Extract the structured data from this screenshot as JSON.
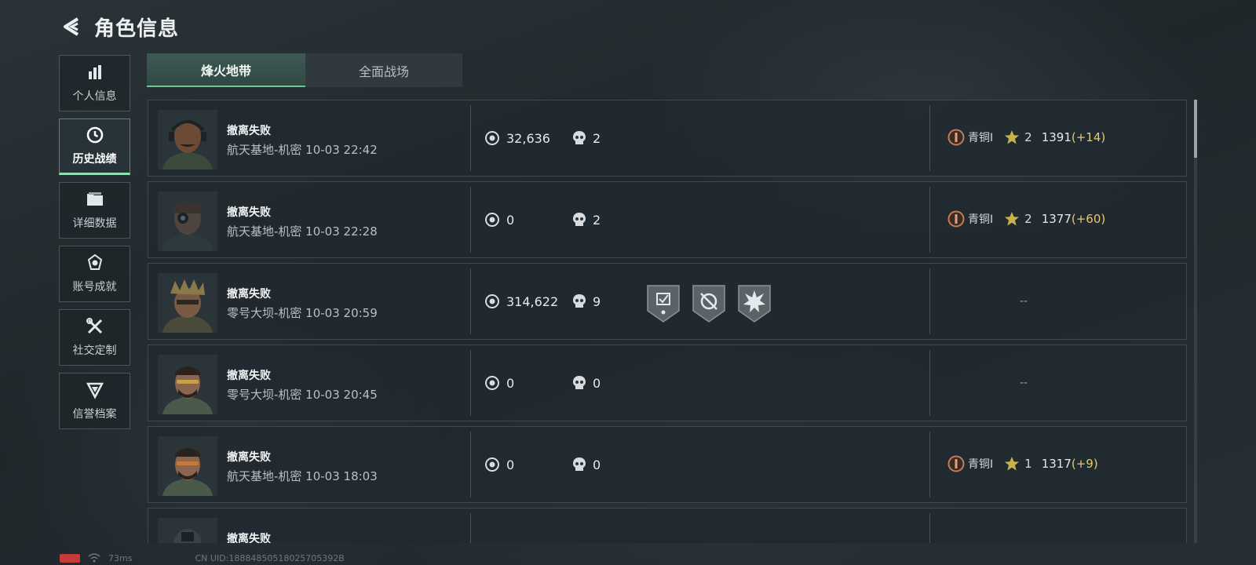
{
  "header": {
    "title": "角色信息"
  },
  "sidebar": {
    "items": [
      {
        "label": "个人信息",
        "icon": "bar-chart-icon"
      },
      {
        "label": "历史战绩",
        "icon": "history-clock-icon"
      },
      {
        "label": "详细数据",
        "icon": "folder-icon"
      },
      {
        "label": "账号成就",
        "icon": "achievement-icon"
      },
      {
        "label": "社交定制",
        "icon": "tools-icon"
      },
      {
        "label": "信誉档案",
        "icon": "shield-icon"
      }
    ],
    "active_index": 1
  },
  "tabs": [
    {
      "label": "烽火地带"
    },
    {
      "label": "全面战场"
    }
  ],
  "matches": [
    {
      "status": "撤离失败",
      "map_time": "航天基地-机密 10-03 22:42",
      "coins": "32,636",
      "kills": "2",
      "rank": {
        "name": "青铜I",
        "stars": "2",
        "score": "1391",
        "delta": "(+14)"
      }
    },
    {
      "status": "撤离失败",
      "map_time": "航天基地-机密 10-03 22:28",
      "coins": "0",
      "kills": "2",
      "rank": {
        "name": "青铜I",
        "stars": "2",
        "score": "1377",
        "delta": "(+60)"
      }
    },
    {
      "status": "撤离失败",
      "map_time": "零号大坝-机密 10-03 20:59",
      "coins": "314,622",
      "kills": "9",
      "badges": [
        "medal-badge-icon",
        "target-badge-icon",
        "explosion-badge-icon"
      ],
      "rank_text": "--"
    },
    {
      "status": "撤离失败",
      "map_time": "零号大坝-机密 10-03 20:45",
      "coins": "0",
      "kills": "0",
      "rank_text": "--"
    },
    {
      "status": "撤离失败",
      "map_time": "航天基地-机密 10-03 18:03",
      "coins": "0",
      "kills": "0",
      "rank": {
        "name": "青铜I",
        "stars": "1",
        "score": "1317",
        "delta": "(+9)"
      }
    },
    {
      "status": "撤离失败"
    }
  ],
  "status_bar": {
    "ping": "73ms",
    "uid": "CN UID:18884850518025705392B"
  },
  "colors": {
    "accent": "#8fe0b0",
    "delta": "#e8c86a",
    "rank_bronze": "#c97a55",
    "star": "#c8b24a"
  }
}
